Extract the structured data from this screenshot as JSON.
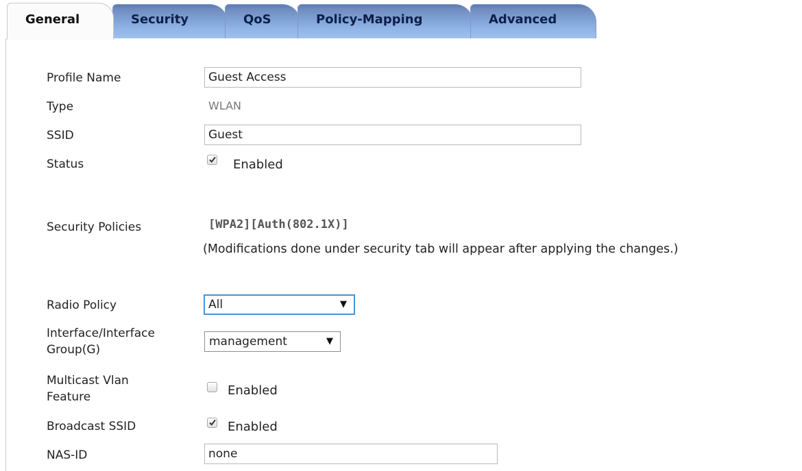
{
  "tabs": [
    {
      "label": "General",
      "active": true
    },
    {
      "label": "Security",
      "active": false
    },
    {
      "label": "QoS",
      "active": false
    },
    {
      "label": "Policy-Mapping",
      "active": false
    },
    {
      "label": "Advanced",
      "active": false
    }
  ],
  "form": {
    "profile_name": {
      "label": "Profile Name",
      "value": "Guest Access"
    },
    "type": {
      "label": "Type",
      "value": "WLAN"
    },
    "ssid": {
      "label": "SSID",
      "value": "Guest"
    },
    "status": {
      "label": "Status",
      "checkbox_label": "Enabled",
      "checked": true
    },
    "security_policies": {
      "label": "Security Policies",
      "value": "[WPA2][Auth(802.1X)]",
      "note": "(Modifications done under security tab will appear after applying the changes.)"
    },
    "radio_policy": {
      "label": "Radio Policy",
      "selected": "All"
    },
    "interface_group": {
      "label_line1": "Interface/Interface",
      "label_line2": "Group(G)",
      "selected": "management"
    },
    "multicast_vlan": {
      "label_line1": "Multicast Vlan",
      "label_line2": "Feature",
      "checkbox_label": "Enabled",
      "checked": false
    },
    "broadcast_ssid": {
      "label": "Broadcast SSID",
      "checkbox_label": "Enabled",
      "checked": true
    },
    "nas_id": {
      "label": "NAS-ID",
      "value": "none"
    }
  },
  "icons": {
    "dropdown": "chevron-down-icon",
    "check": "checkmark-icon"
  },
  "colors": {
    "tab_gradient_top": "#5d7bb2",
    "tab_gradient_bottom": "#9fc2ee",
    "focus_border": "#4d8fd8"
  }
}
